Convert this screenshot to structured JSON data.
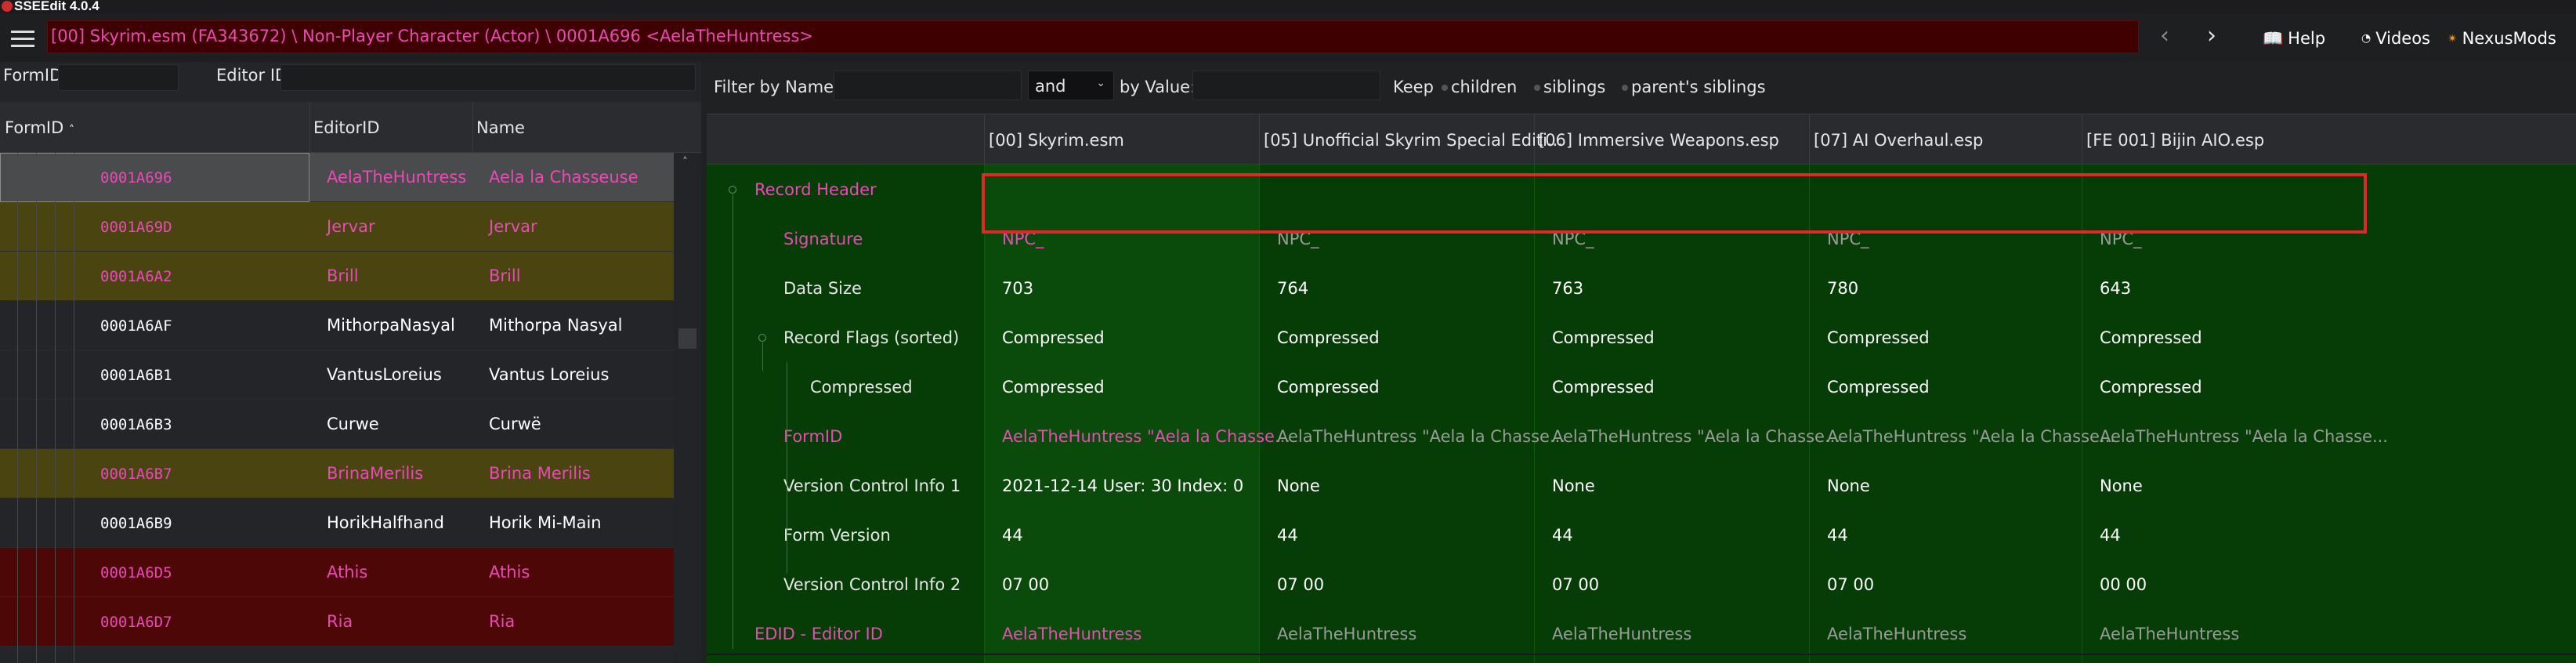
{
  "app": {
    "title": "SSEEdit 4.0.4"
  },
  "toolbar": {
    "path": "[00] Skyrim.esm (FA343672) \\ Non-Player Character (Actor) \\ 0001A696 <AelaTheHuntress>",
    "back_glyph": "‹",
    "forward_glyph": "›",
    "help_label": "Help",
    "videos_label": "Videos",
    "nexus_label": "NexusMods",
    "help_icon": "📖",
    "videos_icon": "◔",
    "nexus_icon": "✴"
  },
  "left_filters": {
    "formid_label": "FormID",
    "editorid_label": "Editor ID"
  },
  "left_columns": {
    "formid": "FormID",
    "sort_glyph": "˄",
    "editorid": "EditorID",
    "name": "Name"
  },
  "records_list": [
    {
      "formid": "0001A696",
      "editorid": "AelaTheHuntress",
      "name": "Aela la Chasseuse",
      "state": "selected"
    },
    {
      "formid": "0001A69D",
      "editorid": "Jervar",
      "name": "Jervar",
      "state": "overridden"
    },
    {
      "formid": "0001A6A2",
      "editorid": "Brill",
      "name": "Brill",
      "state": "overridden"
    },
    {
      "formid": "0001A6AF",
      "editorid": "MithorpaNasyal",
      "name": "Mithorpa Nasyal",
      "state": "normal"
    },
    {
      "formid": "0001A6B1",
      "editorid": "VantusLoreius",
      "name": "Vantus Loreius",
      "state": "normal"
    },
    {
      "formid": "0001A6B3",
      "editorid": "Curwe",
      "name": "Curwë",
      "state": "normal"
    },
    {
      "formid": "0001A6B7",
      "editorid": "BrinaMerilis",
      "name": "Brina Merilis",
      "state": "overridden"
    },
    {
      "formid": "0001A6B9",
      "editorid": "HorikHalfhand",
      "name": "Horik Mi-Main",
      "state": "normal"
    },
    {
      "formid": "0001A6D5",
      "editorid": "Athis",
      "name": "Athis",
      "state": "conflict"
    },
    {
      "formid": "0001A6D7",
      "editorid": "Ria",
      "name": "Ria",
      "state": "conflict"
    }
  ],
  "filter": {
    "by_name_label": "Filter by Name:",
    "and_value": "and",
    "dropdown_glyph": "⌄",
    "by_value_label": "by Value:",
    "keep_label": "Keep",
    "children_label": "children",
    "siblings_label": "siblings",
    "parents_siblings_label": "parent's siblings"
  },
  "plugins": [
    "[00] Skyrim.esm",
    "[05] Unofficial Skyrim Special Editi...",
    "[06] Immersive Weapons.esp",
    "[07] AI Overhaul.esp",
    "[FE 001] Bijin AIO.esp"
  ],
  "record_rows": [
    {
      "label": "Record Header",
      "kind": "group",
      "values": [
        "",
        "",
        "",
        "",
        ""
      ]
    },
    {
      "label": "Signature",
      "kind": "magenta",
      "values": [
        "NPC_",
        "NPC_",
        "NPC_",
        "NPC_",
        "NPC_"
      ]
    },
    {
      "label": "Data Size",
      "kind": "normal",
      "values": [
        "703",
        "764",
        "763",
        "780",
        "643"
      ]
    },
    {
      "label": "Record Flags (sorted)",
      "kind": "normal",
      "values": [
        "Compressed",
        "Compressed",
        "Compressed",
        "Compressed",
        "Compressed"
      ]
    },
    {
      "label": "Compressed",
      "kind": "normal",
      "values": [
        "Compressed",
        "Compressed",
        "Compressed",
        "Compressed",
        "Compressed"
      ]
    },
    {
      "label": "FormID",
      "kind": "magenta",
      "values": [
        "AelaTheHuntress \"Aela la Chasse...",
        "AelaTheHuntress \"Aela la Chasse...",
        "AelaTheHuntress \"Aela la Chasse...",
        "AelaTheHuntress \"Aela la Chasse...",
        "AelaTheHuntress \"Aela la Chasse..."
      ]
    },
    {
      "label": "Version Control Info 1",
      "kind": "normal",
      "values": [
        "2021-12-14 User: 30 Index: 0",
        "None",
        "None",
        "None",
        "None"
      ]
    },
    {
      "label": "Form Version",
      "kind": "normal",
      "values": [
        "44",
        "44",
        "44",
        "44",
        "44"
      ]
    },
    {
      "label": "Version Control Info 2",
      "kind": "normal",
      "values": [
        "07 00",
        "07 00",
        "07 00",
        "07 00",
        "00 00"
      ]
    },
    {
      "label": "EDID - Editor ID",
      "kind": "magenta-group",
      "values": [
        "AelaTheHuntress",
        "AelaTheHuntress",
        "AelaTheHuntress",
        "AelaTheHuntress",
        "AelaTheHuntress"
      ]
    }
  ],
  "colors": {
    "magenta": "#e94bb4",
    "grey": "#9a9a9a",
    "path_bg": "#3e0000",
    "selected_bg": "#4a4b4d",
    "overridden_bg": "#4a4410",
    "conflict_bg": "#4d0707",
    "records_bg": "#063d06",
    "highlight_box": "#e02828"
  }
}
